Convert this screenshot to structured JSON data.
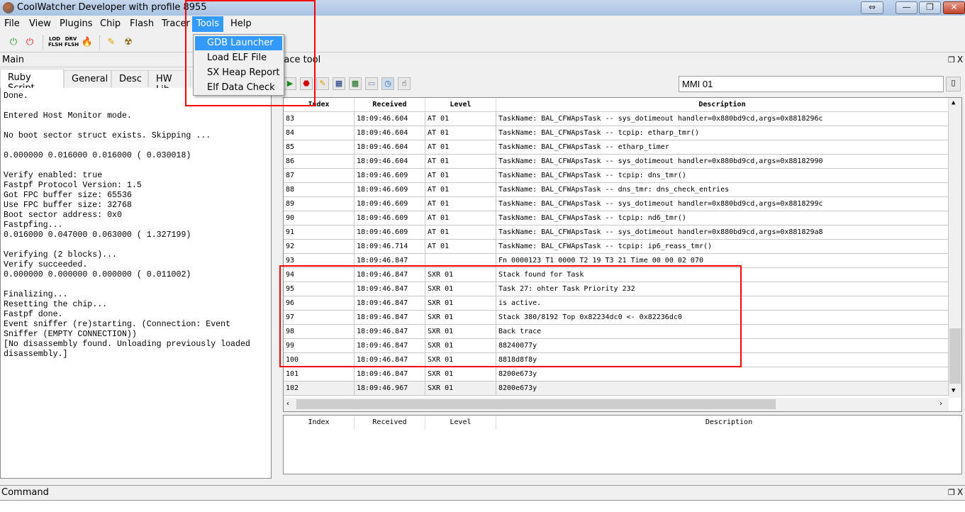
{
  "window": {
    "title": "CoolWatcher Developer with profile 8955",
    "controls": {
      "swap": "⇔",
      "minimize": "—",
      "restore": "❐",
      "close": "✕"
    }
  },
  "menubar": [
    "File",
    "View",
    "Plugins",
    "Chip",
    "Flash",
    "Tracer",
    "Tools",
    "Help"
  ],
  "tools_menu": {
    "items": [
      "GDB Launcher",
      "Load ELF File",
      "SX Heap Report",
      "Elf Data Check"
    ],
    "highlighted": 0
  },
  "main_panel": {
    "title": "Main",
    "tabs": [
      "Ruby Script",
      "General",
      "Desc",
      "HW Lib"
    ],
    "active_tab": 0,
    "console": "Done.\n\nEntered Host Monitor mode.\n\nNo boot sector struct exists. Skipping ...\n\n0.000000 0.016000 0.016000 ( 0.030018)\n\nVerify enabled: true\nFastpf Protocol Version: 1.5\nGot FPC buffer size: 65536\nUse FPC buffer size: 32768\nBoot sector address: 0x0\nFastpfing...\n0.016000 0.047000 0.063000 ( 1.327199)\n\nVerifying (2 blocks)...\nVerify succeeded.\n0.000000 0.000000 0.000000 ( 0.011002)\n\nFinalizing...\nResetting the chip...\nFastpf done.\nEvent sniffer (re)starting. (Connection: Event\nSniffer (EMPTY CONNECTION))\n[No disassembly found. Unloading previously loaded\ndisassembly.]"
  },
  "trace_panel": {
    "title": "Trace tool",
    "filter_value": "MMI 01",
    "columns": [
      "Index",
      "Received",
      "Level",
      "Description"
    ],
    "rows": [
      [
        "83",
        "18:09:46.604",
        "AT 01",
        "TaskName: BAL_CFWApsTask -- sys_dotimeout handler=0x880bd9cd,args=0x8818296c"
      ],
      [
        "84",
        "18:09:46.604",
        "AT 01",
        "TaskName: BAL_CFWApsTask -- tcpip: etharp_tmr()"
      ],
      [
        "85",
        "18:09:46.604",
        "AT 01",
        "TaskName: BAL_CFWApsTask -- etharp_timer"
      ],
      [
        "86",
        "18:09:46.604",
        "AT 01",
        "TaskName: BAL_CFWApsTask -- sys_dotimeout handler=0x880bd9cd,args=0x88182990"
      ],
      [
        "87",
        "18:09:46.609",
        "AT 01",
        "TaskName: BAL_CFWApsTask -- tcpip: dns_tmr()"
      ],
      [
        "88",
        "18:09:46.609",
        "AT 01",
        "TaskName: BAL_CFWApsTask -- dns_tmr: dns_check_entries"
      ],
      [
        "89",
        "18:09:46.609",
        "AT 01",
        "TaskName: BAL_CFWApsTask -- sys_dotimeout handler=0x880bd9cd,args=0x8818299c"
      ],
      [
        "90",
        "18:09:46.609",
        "AT 01",
        "TaskName: BAL_CFWApsTask -- tcpip: nd6_tmr()"
      ],
      [
        "91",
        "18:09:46.609",
        "AT 01",
        "TaskName: BAL_CFWApsTask -- sys_dotimeout handler=0x880bd9cd,args=0x881829a8"
      ],
      [
        "92",
        "18:09:46.714",
        "AT 01",
        "TaskName: BAL_CFWApsTask -- tcpip: ip6_reass_tmr()"
      ],
      [
        "93",
        "18:09:46.847",
        "",
        "Fn 0000123 T1 0000 T2 19 T3 21 Time 00 00 02 070"
      ],
      [
        "94",
        "18:09:46.847",
        "SXR 01",
        "Stack found for Task"
      ],
      [
        "95",
        "18:09:46.847",
        "SXR 01",
        "Task 27: ohter Task Priority 232"
      ],
      [
        "96",
        "18:09:46.847",
        "SXR 01",
        "is active."
      ],
      [
        "97",
        "18:09:46.847",
        "SXR 01",
        "Stack 380/8192 Top 0x82234dc0 <- 0x82236dc0"
      ],
      [
        "98",
        "18:09:46.847",
        "SXR 01",
        "Back trace"
      ],
      [
        "99",
        "18:09:46.847",
        "SXR 01",
        "88240077y"
      ],
      [
        "100",
        "18:09:46.847",
        "SXR 01",
        "8818d8f8y"
      ],
      [
        "101",
        "18:09:46.847",
        "SXR 01",
        "8200e673y"
      ],
      [
        "102",
        "18:09:46.967",
        "SXR 01",
        "8200e673y"
      ]
    ],
    "selected_row": "102"
  },
  "command_panel": {
    "title": "Command"
  },
  "colors": {
    "highlight": "#3399ff",
    "annotation": "#ff0000"
  }
}
